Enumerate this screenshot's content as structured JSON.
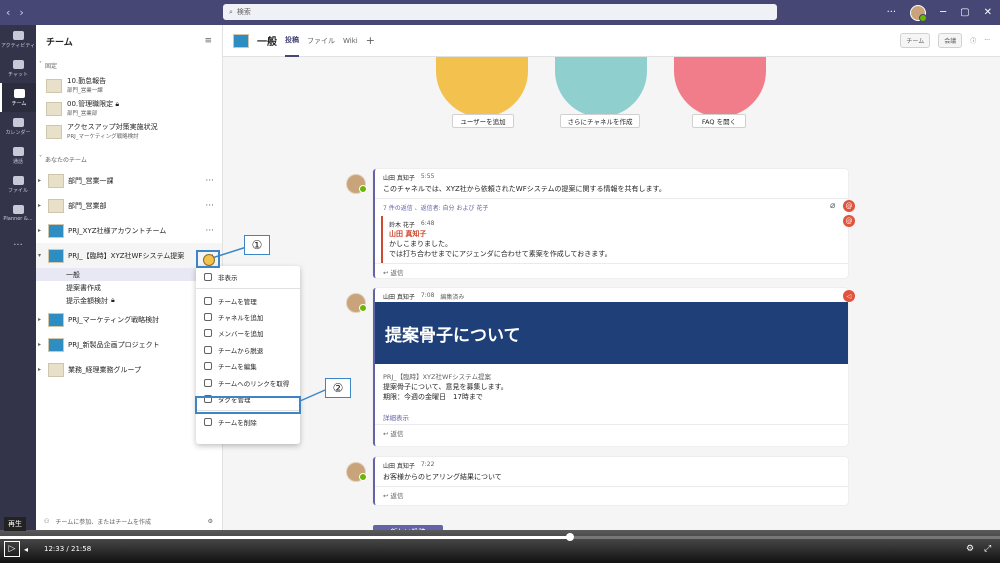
{
  "search": {
    "placeholder": "検索"
  },
  "rail": [
    {
      "label": "アクティビティ"
    },
    {
      "label": "チャット"
    },
    {
      "label": "チーム"
    },
    {
      "label": "カレンダー"
    },
    {
      "label": "通話"
    },
    {
      "label": "ファイル"
    },
    {
      "label": "Planner &..."
    },
    {
      "label": "..."
    }
  ],
  "panel": {
    "title": "チーム",
    "pinned_label": "固定",
    "pinned": [
      {
        "name": "10.勤怠報告",
        "sub": "部門_営業一課"
      },
      {
        "name": "00.管理職限定",
        "sub": "部門_営業部"
      },
      {
        "name": "アクセスアップ対策実施状況",
        "sub": "PRJ_マーケティング戦略検討"
      }
    ],
    "your_teams_label": "あなたのチーム",
    "teams": [
      {
        "name": "部門_営業一課"
      },
      {
        "name": "部門_営業部"
      },
      {
        "name": "PRJ_XYZ社様アカウントチーム"
      },
      {
        "name": "PRJ_【臨時】XYZ社WFシステム提案"
      },
      {
        "name": "PRJ_マーケティング戦略検討"
      },
      {
        "name": "PRJ_新製品企画プロジェクト"
      },
      {
        "name": "業務_経理業務グループ"
      }
    ],
    "channels": [
      {
        "name": "一般"
      },
      {
        "name": "提案書作成"
      },
      {
        "name": "提示金額検討"
      }
    ],
    "footer": "チームに参加、またはチームを作成"
  },
  "channel": {
    "title": "一般",
    "tabs": [
      "投稿",
      "ファイル",
      "Wiki"
    ],
    "add": "+",
    "team_btn": "チーム",
    "meet_btn": "会議"
  },
  "actions": [
    "ユーザーを追加",
    "さらにチャネルを作成",
    "FAQ を開く"
  ],
  "messages": [
    {
      "author": "山田 真知子",
      "time": "5:55",
      "text": "このチャネルでは、XYZ社から依頼されたWFシステムの提案に関する情報を共有します。",
      "replies_note": "7 件の返信 、返信者: 自分 および 花子",
      "sub": {
        "author": "鈴木 花子",
        "time": "6:48",
        "mention": "山田 真知子",
        "text1": "かしこまりました。",
        "text2": "では打ち合わせまでにアジェンダに合わせて素案を作成しておきます。"
      },
      "reply": "返信"
    },
    {
      "author": "山田 真知子",
      "time": "7:08",
      "edited": "編集済み",
      "banner": "提案骨子について",
      "line1": "PRJ_【臨時】XYZ社WFシステム提案",
      "line2": "提案骨子について、意見を募集します。",
      "line3": "期限：今週の金曜日　17時まで",
      "more": "詳細表示",
      "reply": "返信"
    },
    {
      "author": "山田 真知子",
      "time": "7:22",
      "text": "お客様からのヒアリング結果について",
      "reply": "返信"
    }
  ],
  "new_post": "新しい投稿",
  "context_menu": [
    "非表示",
    "チームを管理",
    "チャネルを追加",
    "メンバーを追加",
    "チームから脱退",
    "チームを編集",
    "チームへのリンクを取得",
    "タグを管理",
    "チームを削除"
  ],
  "callouts": [
    "①",
    "②"
  ],
  "video": {
    "tooltip": "再生",
    "current": "12:33",
    "total": "21:58",
    "progress": 0.57
  }
}
